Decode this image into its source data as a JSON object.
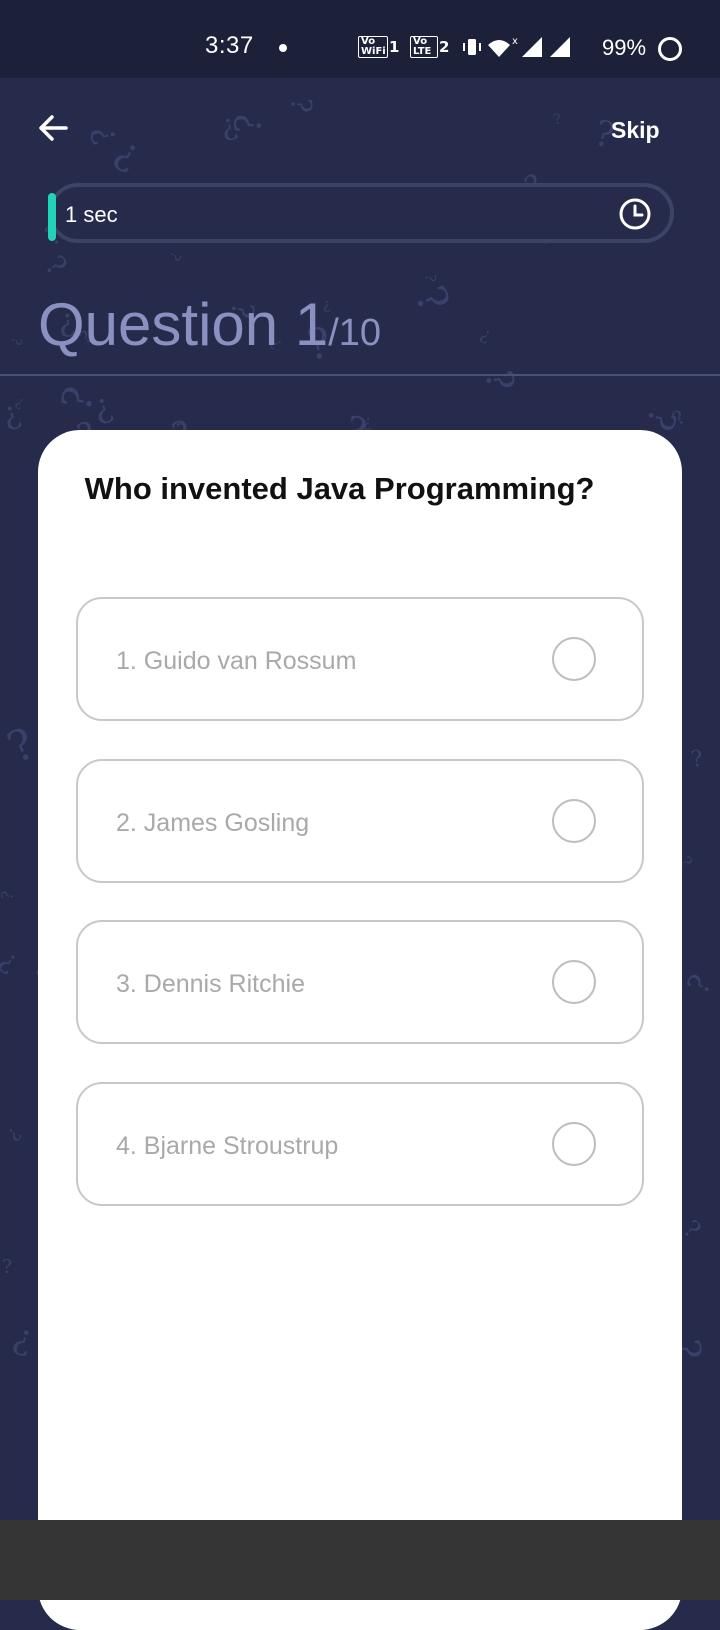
{
  "status_bar": {
    "time": "3:37",
    "badge_wifi_text": "Vo WiFi",
    "badge_wifi_num": "1",
    "badge_lte_text": "Vo LTE",
    "badge_lte_num": "2",
    "battery": "99%"
  },
  "header": {
    "skip_label": "Skip"
  },
  "timer": {
    "label": "1 sec"
  },
  "progress": {
    "prefix": "Question ",
    "current": "1",
    "total": "/10"
  },
  "question": {
    "text": " Who invented Java Programming?",
    "options": [
      "1. Guido van Rossum",
      "2. James Gosling",
      "3. Dennis Ritchie",
      "4. Bjarne Stroustrup"
    ]
  },
  "colors": {
    "background": "#262b4b",
    "accent": "#21d3b8",
    "heading": "#8a91c1"
  }
}
